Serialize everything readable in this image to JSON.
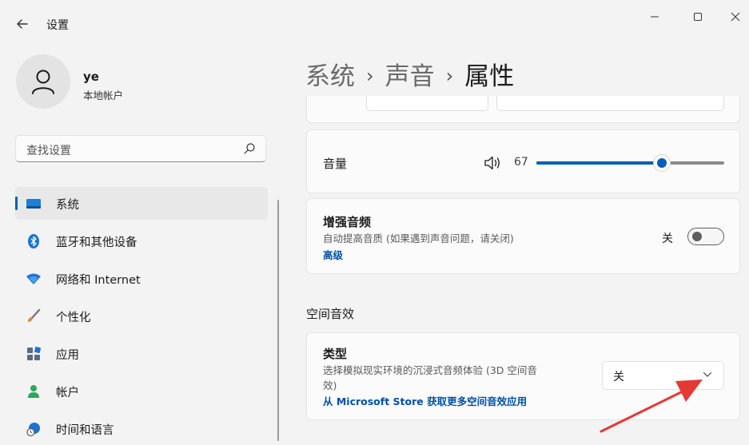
{
  "app": {
    "title": "设置"
  },
  "profile": {
    "name": "ye",
    "account_type": "本地帐户"
  },
  "search": {
    "placeholder": "查找设置"
  },
  "nav": [
    {
      "label": "系统",
      "icon": "monitor-icon",
      "active": true
    },
    {
      "label": "蓝牙和其他设备",
      "icon": "bluetooth-icon"
    },
    {
      "label": "网络和 Internet",
      "icon": "wifi-icon"
    },
    {
      "label": "个性化",
      "icon": "brush-icon"
    },
    {
      "label": "应用",
      "icon": "apps-icon"
    },
    {
      "label": "帐户",
      "icon": "person-icon"
    },
    {
      "label": "时间和语言",
      "icon": "clock-globe-icon"
    }
  ],
  "breadcrumb": {
    "level1": "系统",
    "sep": "›",
    "level2": "声音",
    "current": "属性"
  },
  "volume": {
    "label": "音量",
    "value": "67",
    "level_percent": 67,
    "icon": "speaker-icon"
  },
  "enhance": {
    "title": "增强音频",
    "description": "自动提高音质 (如果遇到声音问题，请关闭)",
    "link": "高级",
    "state_label": "关",
    "enabled": false
  },
  "spatial": {
    "section_title": "空间音效",
    "type_title": "类型",
    "description_line1": "选择模拟现实环境的沉浸式音频体验 (3D 空间音",
    "description_line2": "效)",
    "link": "从 Microsoft Store 获取更多空间音效应用",
    "selected": "关"
  },
  "colors": {
    "accent": "#005fb8",
    "annotation_arrow": "#e53935"
  }
}
